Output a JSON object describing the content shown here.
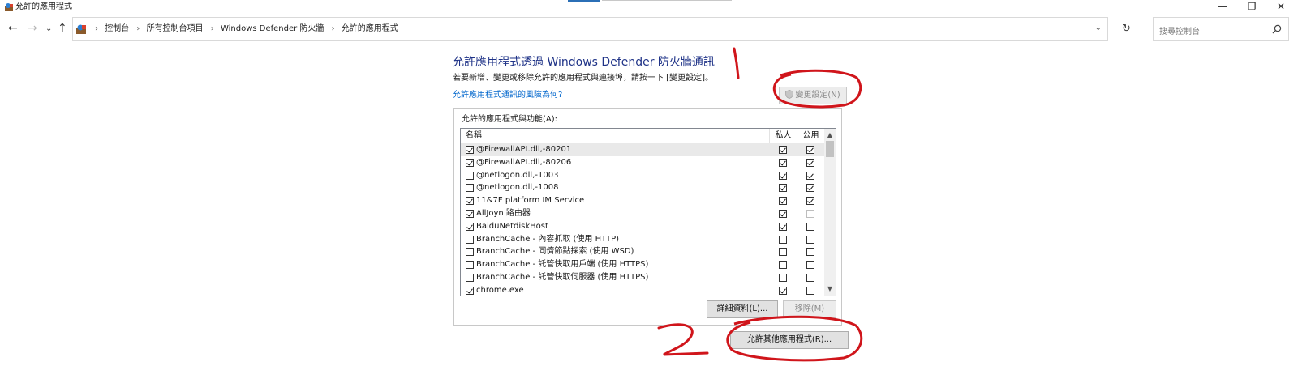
{
  "window": {
    "title": "允許的應用程式",
    "controls": {
      "minimize": "—",
      "restore": "❐",
      "close": "✕"
    }
  },
  "nav": {
    "back": "←",
    "forward": "→",
    "recent": "⌄",
    "up": "↑",
    "refresh": "↻"
  },
  "address": {
    "breadcrumbs": [
      "控制台",
      "所有控制台項目",
      "Windows Defender 防火牆",
      "允許的應用程式"
    ],
    "separator": "›",
    "dropdown": "⌄"
  },
  "search": {
    "placeholder": "搜尋控制台"
  },
  "main": {
    "heading": "允許應用程式透過 Windows Defender 防火牆通訊",
    "intro": "若要新增、變更或移除允許的應用程式與連接埠，請按一下 [變更設定]。",
    "risk_link": "允許應用程式通訊的風險為何?",
    "change_settings_label": "變更設定(N)",
    "list_label": "允許的應用程式與功能(A):",
    "columns": {
      "name": "名稱",
      "private": "私人",
      "public": "公用"
    },
    "apps": [
      {
        "name": "@FirewallAPI.dll,-80201",
        "enabled": true,
        "private": true,
        "public": true
      },
      {
        "name": "@FirewallAPI.dll,-80206",
        "enabled": true,
        "private": true,
        "public": true
      },
      {
        "name": "@netlogon.dll,-1003",
        "enabled": false,
        "private": true,
        "public": true
      },
      {
        "name": "@netlogon.dll,-1008",
        "enabled": false,
        "private": true,
        "public": true
      },
      {
        "name": "11&7F platform IM Service",
        "enabled": true,
        "private": true,
        "public": true
      },
      {
        "name": "AllJoyn 路由器",
        "enabled": true,
        "private": true,
        "public": false
      },
      {
        "name": "BaiduNetdiskHost",
        "enabled": true,
        "private": true,
        "public": false
      },
      {
        "name": "BranchCache - 內容抓取 (使用 HTTP)",
        "enabled": false,
        "private": false,
        "public": false
      },
      {
        "name": "BranchCache - 同儕節點探索 (使用 WSD)",
        "enabled": false,
        "private": false,
        "public": false
      },
      {
        "name": "BranchCache - 託管快取用戶端 (使用 HTTPS)",
        "enabled": false,
        "private": false,
        "public": false
      },
      {
        "name": "BranchCache - 託管快取伺服器 (使用 HTTPS)",
        "enabled": false,
        "private": false,
        "public": false
      },
      {
        "name": "chrome.exe",
        "enabled": true,
        "private": true,
        "public": false
      }
    ],
    "details_label": "詳細資料(L)...",
    "remove_label": "移除(M)",
    "allow_other_label": "允許其他應用程式(R)..."
  },
  "annotations": {
    "mark_1": "1",
    "mark_2": "2",
    "ink_color": "#d0151b"
  },
  "colors": {
    "heading": "#1e3287",
    "link": "#0066cc"
  }
}
